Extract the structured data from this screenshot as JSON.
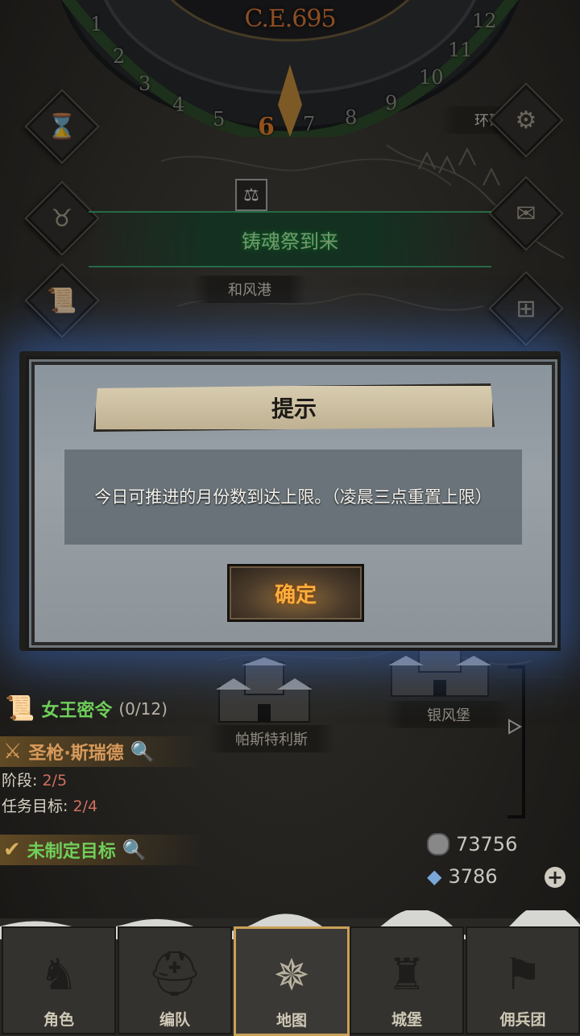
{
  "calendar": {
    "era": "C.E.695",
    "months": [
      "1",
      "2",
      "3",
      "4",
      "5",
      "6",
      "7",
      "8",
      "9",
      "10",
      "11",
      "12"
    ],
    "current_month": "6"
  },
  "side_buttons": {
    "left": [
      "hourglass-icon",
      "bag-icon",
      "scroll-icon"
    ],
    "right": [
      "gear-icon",
      "mail-icon",
      "grid-icon"
    ]
  },
  "map_labels": {
    "top_right": "环礁",
    "harbor": "和风港",
    "festival": "铸魂祭到来",
    "castle_left": "帕斯特利斯",
    "castle_right": "银风堡"
  },
  "dialog": {
    "title": "提示",
    "message": "今日可推进的月份数到达上限。（凌晨三点重置上限）",
    "confirm": "确定"
  },
  "quests": {
    "queen_order": {
      "label": "女王密令",
      "progress": "(0/12)"
    },
    "main": {
      "name": "圣枪·斯瑞德",
      "stage_label": "阶段:",
      "stage_value": "2/5",
      "target_label": "任务目标:",
      "target_value": "2/4"
    },
    "unset": {
      "label": "未制定目标"
    }
  },
  "currency": {
    "coins": "73756",
    "crystals": "3786"
  },
  "nav": [
    {
      "label": "角色",
      "icon": "knight-icon"
    },
    {
      "label": "编队",
      "icon": "helmet-icon"
    },
    {
      "label": "地图",
      "icon": "compass-icon"
    },
    {
      "label": "城堡",
      "icon": "castle-icon"
    },
    {
      "label": "佣兵团",
      "icon": "banner-icon"
    }
  ],
  "nav_active": "地图",
  "colors": {
    "dialog_glow": "#3c6ec8",
    "confirm_text": "#ffae3c",
    "quest_green": "#6fcf5a",
    "festival_green": "#3aa36a",
    "era": "#d9783a"
  }
}
